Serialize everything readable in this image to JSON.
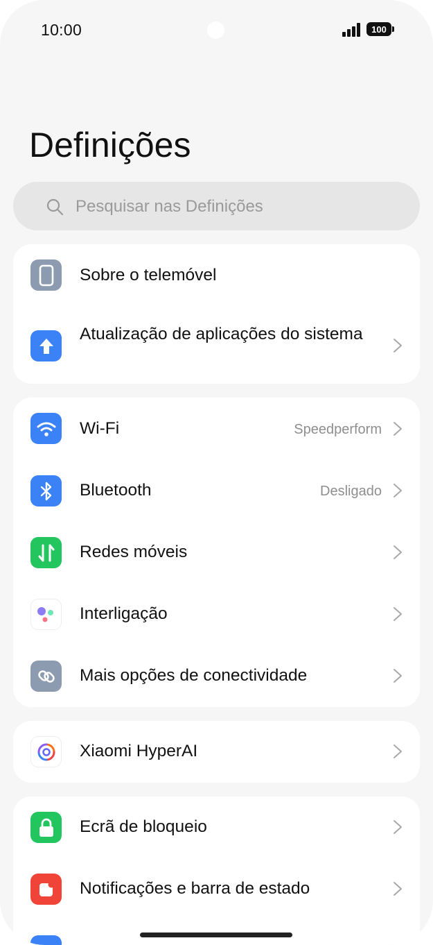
{
  "status_bar": {
    "time": "10:00",
    "battery": "100"
  },
  "page": {
    "title": "Definições"
  },
  "search": {
    "placeholder": "Pesquisar nas Definições"
  },
  "groups": [
    {
      "items": [
        {
          "label": "Sobre o telemóvel",
          "icon": "phone-icon"
        },
        {
          "label": "Atualização de aplicações do sistema",
          "icon": "update-arrow-icon"
        }
      ]
    },
    {
      "items": [
        {
          "label": "Wi-Fi",
          "value": "Speedperform",
          "icon": "wifi-icon"
        },
        {
          "label": "Bluetooth",
          "value": "Desligado",
          "icon": "bluetooth-icon"
        },
        {
          "label": "Redes móveis",
          "icon": "mobile-data-icon"
        },
        {
          "label": "Interligação",
          "icon": "interconnect-icon"
        },
        {
          "label": "Mais opções de conectividade",
          "icon": "link-icon"
        }
      ]
    },
    {
      "items": [
        {
          "label": "Xiaomi HyperAI",
          "icon": "hyperai-icon"
        }
      ]
    },
    {
      "items": [
        {
          "label": "Ecrã de bloqueio",
          "icon": "lock-icon"
        },
        {
          "label": "Notificações e barra de estado",
          "icon": "notification-icon"
        }
      ]
    }
  ],
  "colors": {
    "blue": "#3b82f6",
    "gray_icon": "#8d9bb0",
    "green": "#22c55e",
    "red": "#f04438",
    "background": "#f6f6f6",
    "card": "#ffffff"
  }
}
